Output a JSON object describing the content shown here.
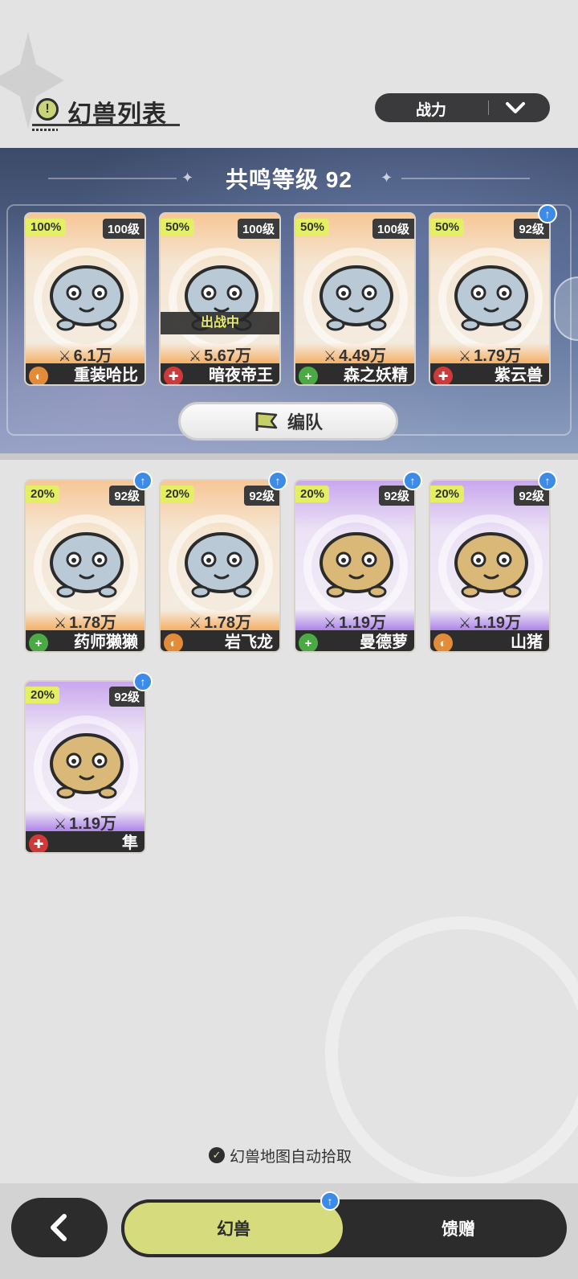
{
  "header": {
    "title": "幻兽列表",
    "sort_label": "战力"
  },
  "team": {
    "resonance_label": "共鸣等级 92",
    "formation_label": "编队",
    "members": [
      {
        "pct": "100%",
        "level": "100级",
        "power": "6.1万",
        "name": "重装哈比",
        "role": "tank",
        "rarity": "orange",
        "upgrade": false,
        "deployed": false,
        "icon": "knight-helmet-pet-icon"
      },
      {
        "pct": "50%",
        "level": "100级",
        "power": "5.67万",
        "name": "暗夜帝王",
        "role": "dps",
        "rarity": "orange",
        "upgrade": false,
        "deployed": true,
        "deployed_label": "出战中",
        "icon": "night-emperor-pet-icon"
      },
      {
        "pct": "50%",
        "level": "100级",
        "power": "4.49万",
        "name": "森之妖精",
        "role": "heal",
        "rarity": "orange",
        "upgrade": false,
        "deployed": false,
        "icon": "forest-moth-pet-icon"
      },
      {
        "pct": "50%",
        "level": "92级",
        "power": "1.79万",
        "name": "紫云兽",
        "role": "dps",
        "rarity": "orange",
        "upgrade": true,
        "deployed": false,
        "icon": "purple-deer-pet-icon"
      }
    ]
  },
  "roster": [
    {
      "pct": "20%",
      "level": "92级",
      "power": "1.78万",
      "name": "药师獭獭",
      "role": "heal",
      "rarity": "orange",
      "upgrade": true,
      "icon": "otter-pet-icon"
    },
    {
      "pct": "20%",
      "level": "92级",
      "power": "1.78万",
      "name": "岩飞龙",
      "role": "tank",
      "rarity": "orange",
      "upgrade": true,
      "icon": "rock-dragon-pet-icon"
    },
    {
      "pct": "20%",
      "level": "92级",
      "power": "1.19万",
      "name": "曼德萝",
      "role": "heal",
      "rarity": "purple",
      "upgrade": true,
      "icon": "mandrake-pet-icon"
    },
    {
      "pct": "20%",
      "level": "92级",
      "power": "1.19万",
      "name": "山猪",
      "role": "tank",
      "rarity": "purple",
      "upgrade": true,
      "icon": "boar-pet-icon"
    },
    {
      "pct": "20%",
      "level": "92级",
      "power": "1.19万",
      "name": "隼",
      "role": "dps",
      "rarity": "purple",
      "upgrade": true,
      "icon": "falcon-pet-icon"
    }
  ],
  "auto_pick_label": "幻兽地图自动拾取",
  "tabs": {
    "active": "幻兽",
    "inactive": "馈赠"
  },
  "colors": {
    "accent": "#d6db7e",
    "orange_rarity": "#f5b066",
    "purple_rarity": "#ad84ea",
    "dark": "#2c2c2c"
  }
}
